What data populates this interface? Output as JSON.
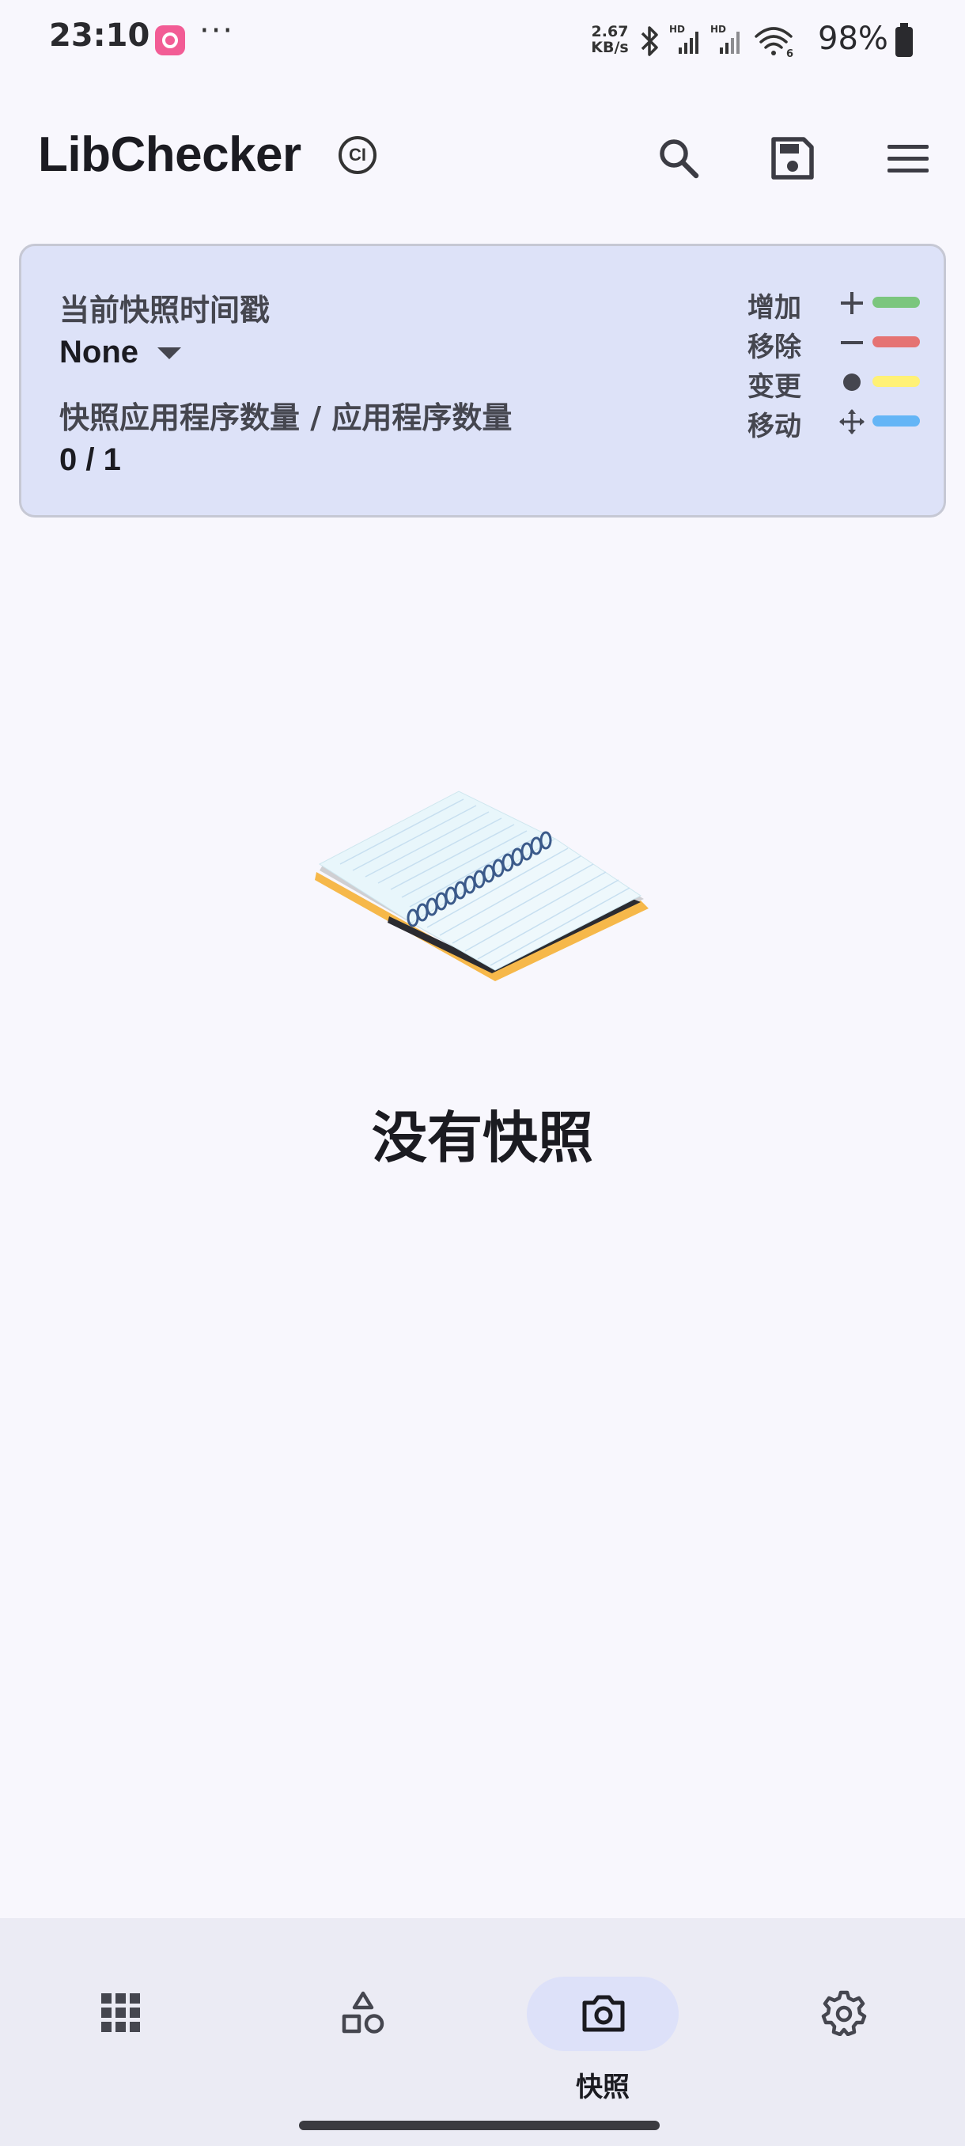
{
  "status_bar": {
    "time": "23:10",
    "more": "···",
    "net_speed_value": "2.67",
    "net_speed_unit": "KB/s",
    "signal_tag_1": "HD",
    "signal_tag_2": "HD",
    "wifi_tag": "6",
    "battery": "98%"
  },
  "toolbar": {
    "title": "LibChecker",
    "badge": "CI",
    "icons": [
      "search-icon",
      "save-icon",
      "menu-icon"
    ]
  },
  "snapshot_card": {
    "timestamp_label": "当前快照时间戳",
    "timestamp_value": "None",
    "count_label": "快照应用程序数量 / 应用程序数量",
    "count_value": "0 / 1",
    "legend": [
      {
        "label": "增加",
        "symbol": "plus",
        "color": "#7bc67e"
      },
      {
        "label": "移除",
        "symbol": "minus",
        "color": "#e57373"
      },
      {
        "label": "变更",
        "symbol": "dot",
        "color": "#fff176"
      },
      {
        "label": "移动",
        "symbol": "move",
        "color": "#64b5f6"
      }
    ]
  },
  "empty_state": {
    "text": "没有快照"
  },
  "bottom_nav": {
    "items": [
      {
        "icon": "apps-grid-icon",
        "label": "",
        "active": false
      },
      {
        "icon": "shapes-icon",
        "label": "",
        "active": false
      },
      {
        "icon": "camera-icon",
        "label": "快照",
        "active": true
      },
      {
        "icon": "settings-icon",
        "label": "",
        "active": false
      }
    ]
  },
  "colors": {
    "background": "#f8f7fd",
    "card": "#dde2f8",
    "nav_background": "#ebebf4",
    "active_pill": "#dde1f9"
  }
}
